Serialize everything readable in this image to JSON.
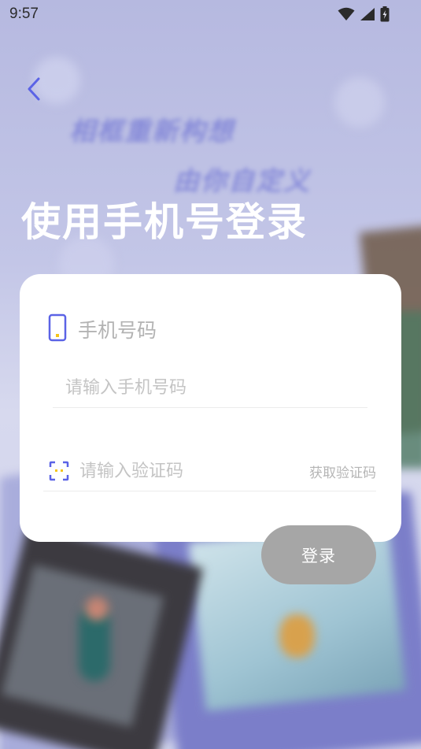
{
  "status_bar": {
    "time": "9:57",
    "icons": [
      "wifi-icon",
      "signal-icon",
      "battery-icon"
    ]
  },
  "background": {
    "slogan_line1": "相框重新构想",
    "slogan_line2": "由你自定义"
  },
  "header": {
    "back_icon": "chevron-left-icon",
    "title": "使用手机号登录"
  },
  "form": {
    "phone_icon": "smartphone-icon",
    "phone_label": "手机号码",
    "phone_placeholder": "请输入手机号码",
    "phone_value": "",
    "code_icon": "verification-code-icon",
    "code_placeholder": "请输入验证码",
    "code_value": "",
    "get_code_label": "获取验证码"
  },
  "actions": {
    "login_label": "登录"
  },
  "colors": {
    "accent": "#5b63e6",
    "icon_yellow": "#f5c518",
    "button_disabled": "#a6a6a6",
    "title_text": "#ffffff"
  }
}
